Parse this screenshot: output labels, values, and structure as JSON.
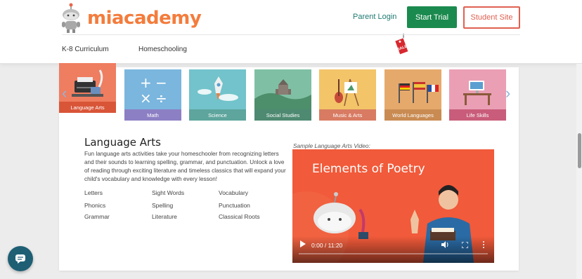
{
  "header": {
    "logo_text": "miacademy",
    "parent_login": "Parent Login",
    "start_trial": "Start Trial",
    "student_site": "Student Site",
    "sale_tag": "SALE",
    "nav": {
      "k8": "K-8 Curriculum",
      "homeschooling": "Homeschooling"
    }
  },
  "subjects": [
    {
      "label": "Language Arts",
      "color": "#e8674a",
      "active": true
    },
    {
      "label": "Math",
      "color": "#8d7fc4"
    },
    {
      "label": "Science",
      "color": "#5da59d"
    },
    {
      "label": "Social Studies",
      "color": "#4e8a72"
    },
    {
      "label": "Music & Arts",
      "color": "#d87b62"
    },
    {
      "label": "World Languages",
      "color": "#c98b52"
    },
    {
      "label": "Life Skills",
      "color": "#c95c7a"
    }
  ],
  "section": {
    "title": "Language Arts",
    "description": "Fun language arts activities take your homeschooler from recognizing letters and their sounds to learning spelling, grammar, and punctuation. Unlock a love of reading through exciting literature and timeless classics that will expand your child's vocabulary and knowledge with every lesson!",
    "links": [
      "Letters",
      "Sight Words",
      "Vocabulary",
      "Phonics",
      "Spelling",
      "Punctuation",
      "Grammar",
      "Literature",
      "Classical Roots"
    ]
  },
  "video": {
    "label": "Sample Language Arts Video:",
    "title": "Elements of Poetry",
    "time": "0:00 / 11:20"
  },
  "colors": {
    "brand": "#f47c3c",
    "trial": "#1b8a4e",
    "student": "#e06050",
    "teal": "#1e7a73",
    "chat": "#1e5f74"
  }
}
